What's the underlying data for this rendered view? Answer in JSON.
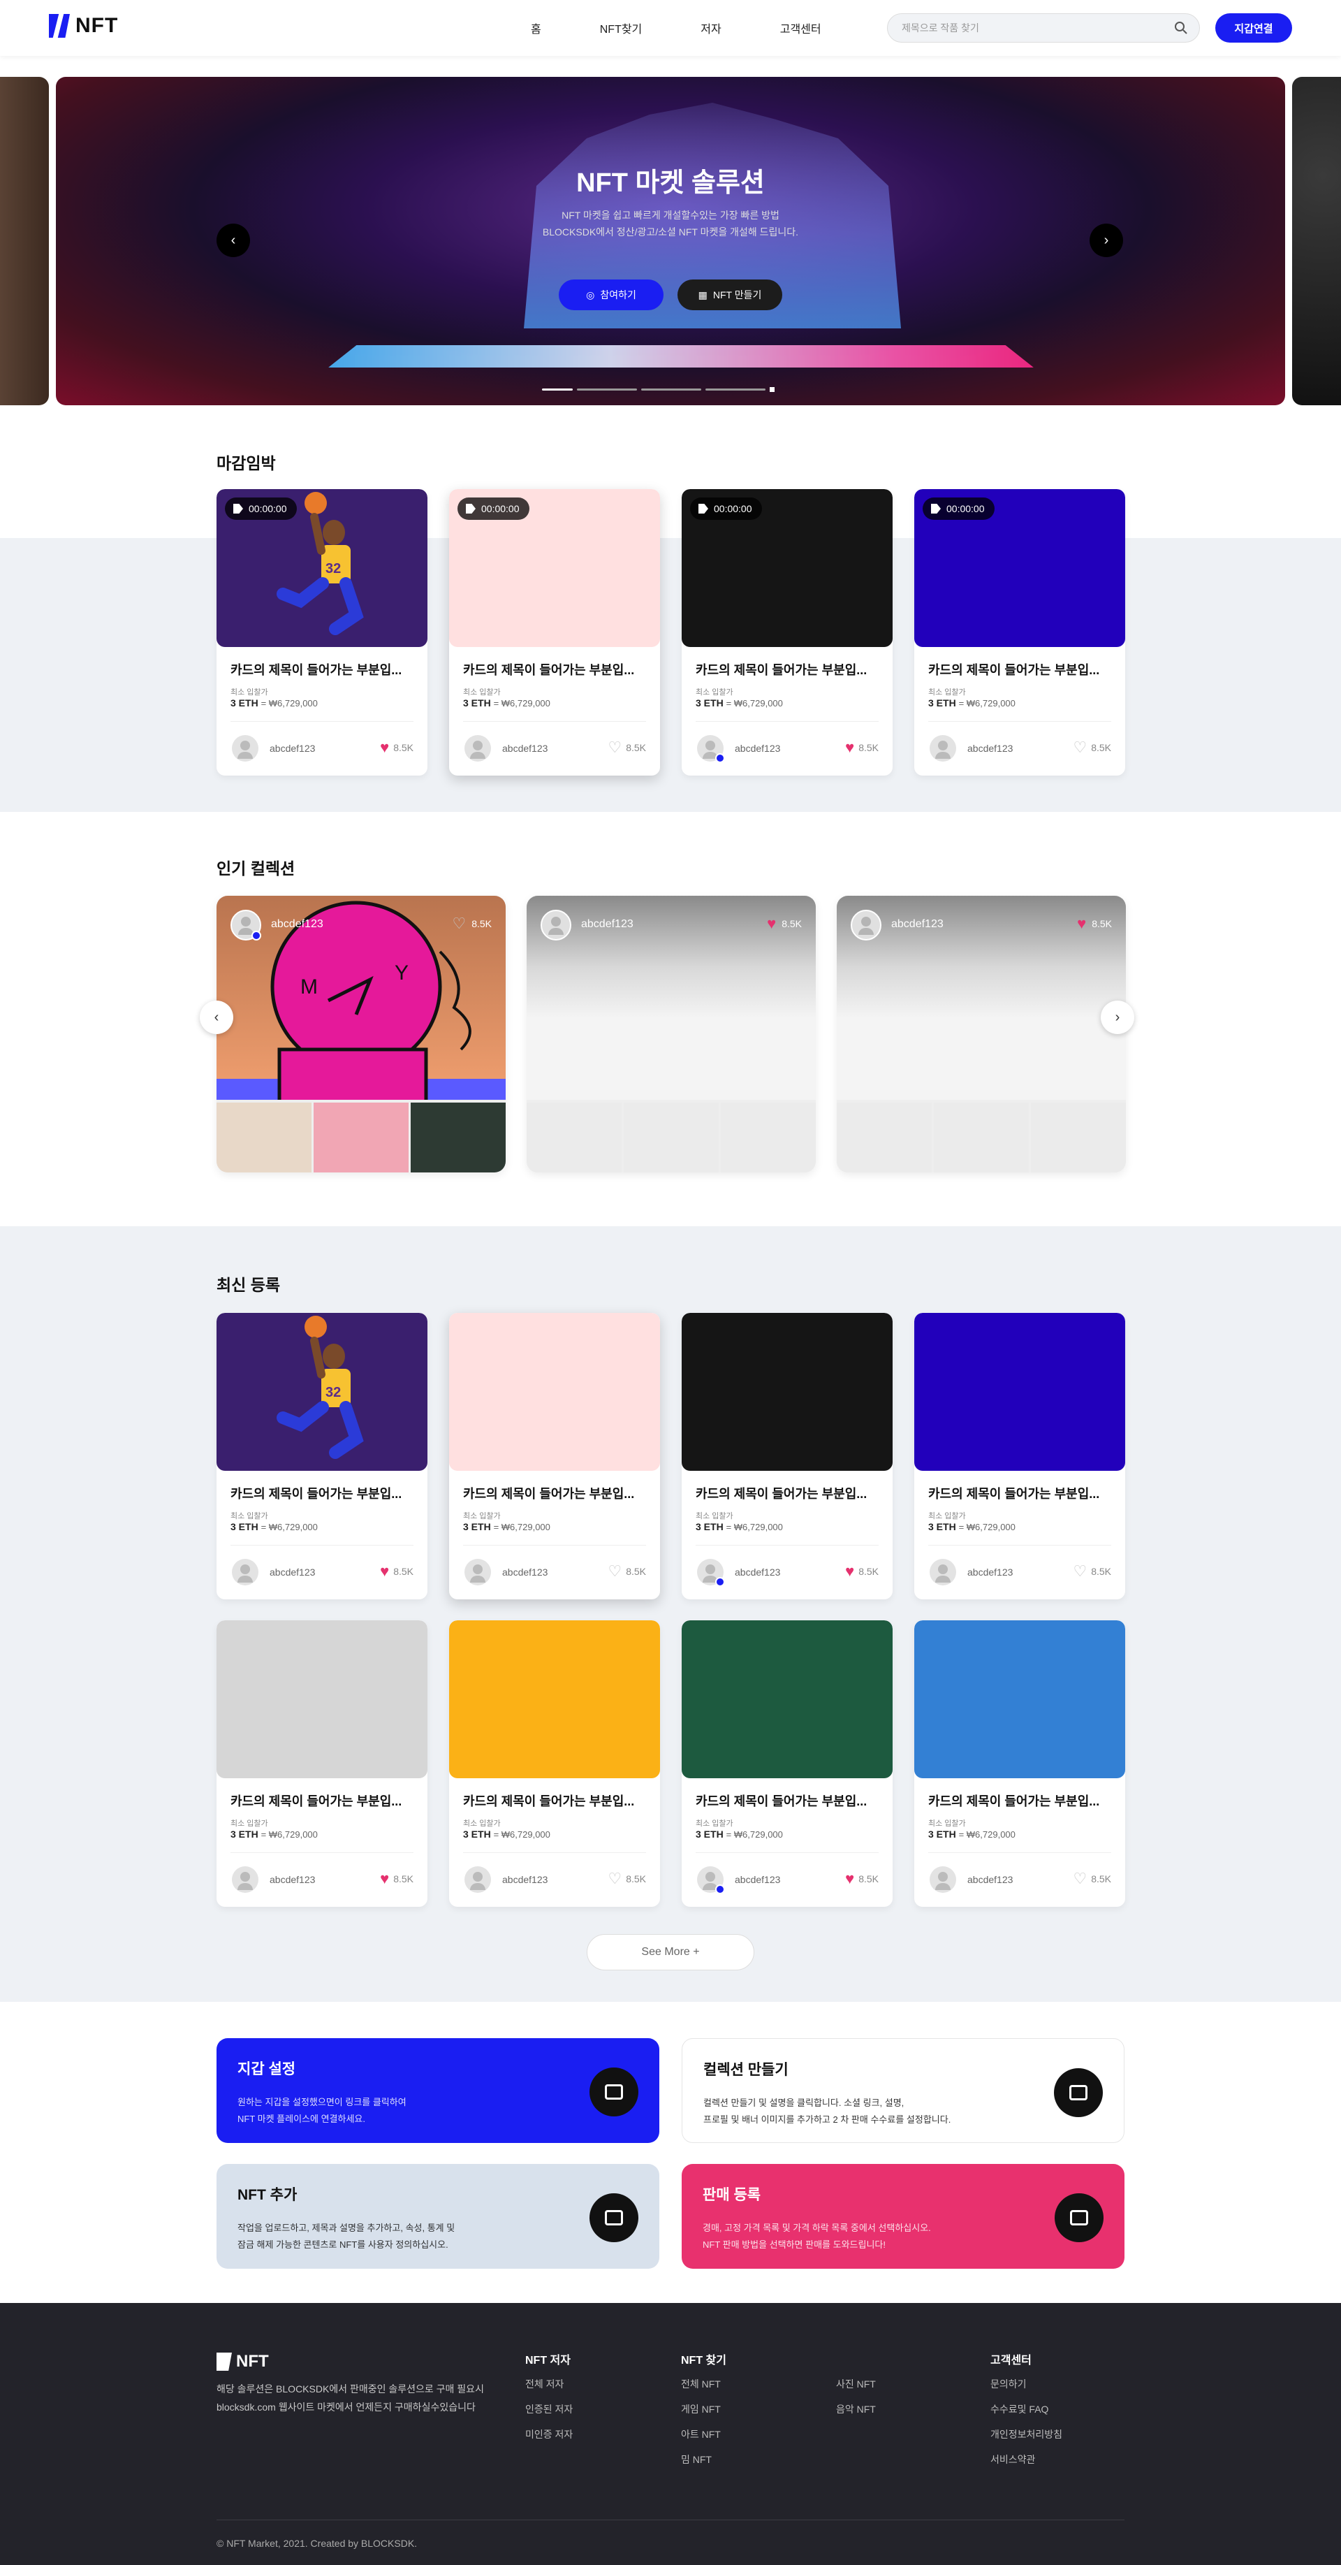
{
  "header": {
    "logo": "NFT",
    "nav": [
      "홈",
      "NFT찾기",
      "저자",
      "고객센터"
    ],
    "search_placeholder": "제목으로 작품 찾기",
    "wallet_button": "지갑연결"
  },
  "hero": {
    "title": "NFT 마켓 솔루션",
    "subtitle_lines": [
      "NFT 마켓을 쉽고 빠르게 개설할수있는 가장 빠른 방법",
      "BLOCKSDK에서 정산/광고/소셜 NFT 마켓을 개설해 드립니다."
    ],
    "button_primary": "참여하기",
    "button_secondary": "NFT 만들기"
  },
  "deadline": {
    "title": "마감임박",
    "cards": [
      {
        "timer": "00:00:00",
        "title": "카드의 제목이 들어가는 부분입...",
        "label": "최소 입찰가",
        "price_eth": "3 ETH",
        "price_krw": "= ₩6,729,000",
        "user": "abcdef123",
        "likes": "8.5K",
        "liked": true,
        "verified": false,
        "color": "#3a1f6e"
      },
      {
        "timer": "00:00:00",
        "title": "카드의 제목이 들어가는 부분입...",
        "label": "최소 입찰가",
        "price_eth": "3 ETH",
        "price_krw": "= ₩6,729,000",
        "user": "abcdef123",
        "likes": "8.5K",
        "liked": false,
        "verified": false,
        "color": "#ffe0e0"
      },
      {
        "timer": "00:00:00",
        "title": "카드의 제목이 들어가는 부분입...",
        "label": "최소 입찰가",
        "price_eth": "3 ETH",
        "price_krw": "= ₩6,729,000",
        "user": "abcdef123",
        "likes": "8.5K",
        "liked": true,
        "verified": true,
        "color": "#151515"
      },
      {
        "timer": "00:00:00",
        "title": "카드의 제목이 들어가는 부분입...",
        "label": "최소 입찰가",
        "price_eth": "3 ETH",
        "price_krw": "= ₩6,729,000",
        "user": "abcdef123",
        "likes": "8.5K",
        "liked": false,
        "verified": false,
        "color": "#2200bb"
      }
    ]
  },
  "collections": {
    "title": "인기 컬렉션",
    "items": [
      {
        "user": "abcdef123",
        "likes": "8.5K"
      },
      {
        "user": "abcdef123",
        "likes": "8.5K"
      },
      {
        "user": "abcdef123",
        "likes": "8.5K"
      }
    ]
  },
  "latest": {
    "title": "최신 등록",
    "cards": [
      {
        "title": "카드의 제목이 들어가는 부분입...",
        "label": "최소 입찰가",
        "price_eth": "3 ETH",
        "price_krw": "= ₩6,729,000",
        "user": "abcdef123",
        "likes": "8.5K",
        "liked": true,
        "verified": false,
        "color": "#3a1f6e"
      },
      {
        "title": "카드의 제목이 들어가는 부분입...",
        "label": "최소 입찰가",
        "price_eth": "3 ETH",
        "price_krw": "= ₩6,729,000",
        "user": "abcdef123",
        "likes": "8.5K",
        "liked": false,
        "verified": false,
        "color": "#ffe0e0"
      },
      {
        "title": "카드의 제목이 들어가는 부분입...",
        "label": "최소 입찰가",
        "price_eth": "3 ETH",
        "price_krw": "= ₩6,729,000",
        "user": "abcdef123",
        "likes": "8.5K",
        "liked": true,
        "verified": true,
        "color": "#151515"
      },
      {
        "title": "카드의 제목이 들어가는 부분입...",
        "label": "최소 입찰가",
        "price_eth": "3 ETH",
        "price_krw": "= ₩6,729,000",
        "user": "abcdef123",
        "likes": "8.5K",
        "liked": false,
        "verified": false,
        "color": "#2200bb"
      },
      {
        "title": "카드의 제목이 들어가는 부분입...",
        "label": "최소 입찰가",
        "price_eth": "3 ETH",
        "price_krw": "= ₩6,729,000",
        "user": "abcdef123",
        "likes": "8.5K",
        "liked": true,
        "verified": false,
        "color": "#d6d6d6"
      },
      {
        "title": "카드의 제목이 들어가는 부분입...",
        "label": "최소 입찰가",
        "price_eth": "3 ETH",
        "price_krw": "= ₩6,729,000",
        "user": "abcdef123",
        "likes": "8.5K",
        "liked": false,
        "verified": false,
        "color": "#fbb116"
      },
      {
        "title": "카드의 제목이 들어가는 부분입...",
        "label": "최소 입찰가",
        "price_eth": "3 ETH",
        "price_krw": "= ₩6,729,000",
        "user": "abcdef123",
        "likes": "8.5K",
        "liked": true,
        "verified": true,
        "color": "#1d5a3f"
      },
      {
        "title": "카드의 제목이 들어가는 부분입...",
        "label": "최소 입찰가",
        "price_eth": "3 ETH",
        "price_krw": "= ₩6,729,000",
        "user": "abcdef123",
        "likes": "8.5K",
        "liked": false,
        "verified": false,
        "color": "#3380d4"
      }
    ],
    "see_more": "See More +"
  },
  "features": [
    {
      "title": "지갑 설정",
      "lines": [
        "원하는 지갑을 설정했으면이 링크를 클릭하여",
        "NFT 마켓 플레이스에 연결하세요."
      ],
      "bg": "#1a1ef2",
      "fg": "#ffffff",
      "icon": "wallet-icon"
    },
    {
      "title": "컬렉션 만들기",
      "lines": [
        "컬렉션 만들기 및 설명을 클릭합니다. 소셜 링크, 설명,",
        "프로필 및 배너 이미지를 추가하고 2 차 판매 수수료를 설정합니다."
      ],
      "bg": "#ffffff",
      "fg": "#111111",
      "icon": "grid-icon"
    },
    {
      "title": "NFT 추가",
      "lines": [
        "작업을 업로드하고, 제목과 설명을 추가하고, 속성, 통계 및",
        "잠금 해제 가능한 콘텐츠로 NFT를 사용자 정의하십시오."
      ],
      "bg": "#d8e1ec",
      "fg": "#111111",
      "icon": "image-icon"
    },
    {
      "title": "판매 등록",
      "lines": [
        "경매, 고정 가격 목록 및 가격 하락 목록 중에서 선택하십시오.",
        "NFT 판매 방법을 선택하면 판매를 도와드립니다!"
      ],
      "bg": "#e8316e",
      "fg": "#ffffff",
      "icon": "cart-icon"
    }
  ],
  "footer": {
    "logo": "NFT",
    "desc_lines": [
      "해당 솔루션은 BLOCKSDK에서 판매중인 솔루션으로 구매 필요시",
      "blocksdk.com 웹사이트 마켓에서 언제든지 구매하실수있습니다"
    ],
    "cols": [
      {
        "title": "NFT 저자",
        "items": [
          "전체 저자",
          "인증된 저자",
          "미인증 저자"
        ]
      },
      {
        "title": "NFT 찾기",
        "items": [
          "전체 NFT",
          "게임 NFT",
          "아트 NFT",
          "밈 NFT"
        ]
      },
      {
        "title": "",
        "items": [
          "사진 NFT",
          "음악 NFT"
        ]
      },
      {
        "title": "고객센터",
        "items": [
          "문의하기",
          "수수료및 FAQ",
          "개인정보처리방침",
          "서비스약관"
        ]
      }
    ],
    "copyright": "© NFT Market, 2021. Created by BLOCKSDK."
  }
}
